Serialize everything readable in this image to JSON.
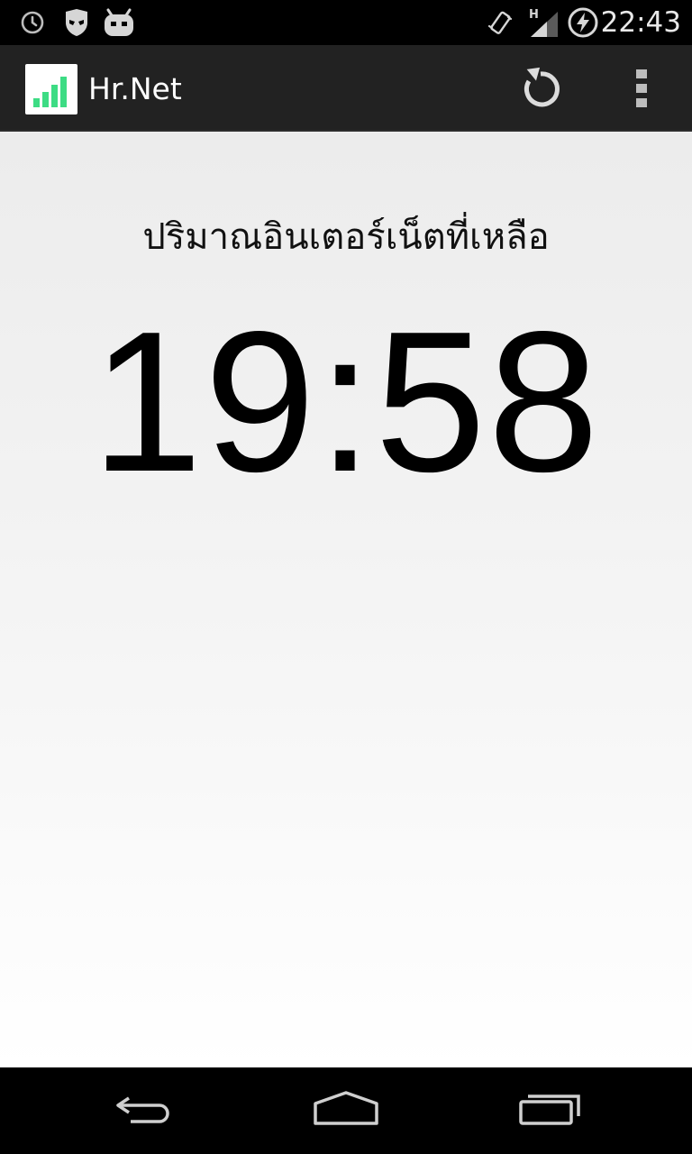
{
  "status_bar": {
    "time": "22:43",
    "left_icons": [
      "alarm-clock-icon",
      "incognito-mask-icon",
      "cyanogenmod-bugdroid-icon"
    ],
    "right_icons": [
      "vibrate-icon",
      "signal-h-icon",
      "battery-charging-icon"
    ],
    "network_type": "H"
  },
  "action_bar": {
    "title": "Hr.Net",
    "app_icon": "signal-bars-icon",
    "actions": [
      "refresh-icon",
      "overflow-menu-icon"
    ],
    "accent_color": "#3ddc84"
  },
  "main": {
    "label": "ปริมาณอินเตอร์เน็ตที่เหลือ",
    "remaining_time": "19:58"
  },
  "nav_bar": {
    "buttons": [
      "back-icon",
      "home-icon",
      "recents-icon"
    ]
  }
}
